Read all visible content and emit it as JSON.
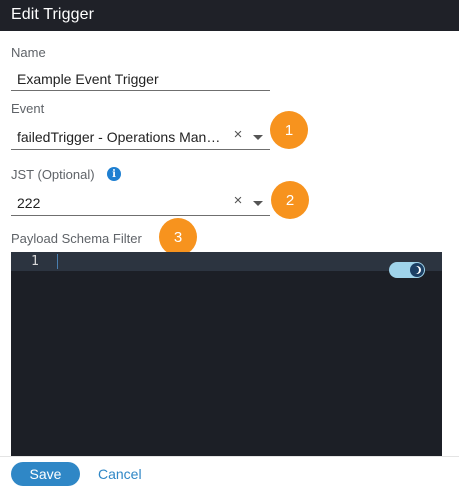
{
  "dialog": {
    "title": "Edit Trigger"
  },
  "name_field": {
    "label": "Name",
    "value": "Example Event Trigger"
  },
  "event_field": {
    "label": "Event",
    "value": "failedTrigger - Operations Mana...",
    "clear_icon": "close-icon",
    "dropdown_icon": "caret-down-icon"
  },
  "jst_field": {
    "label": "JST (Optional)",
    "info_icon": "info-icon",
    "info_glyph": "i",
    "value": "222",
    "clear_icon": "close-icon",
    "dropdown_icon": "caret-down-icon"
  },
  "payload_filter": {
    "label": "Payload Schema Filter",
    "line_number": "1",
    "theme_toggle_icon": "moon-icon"
  },
  "callouts": [
    "1",
    "2",
    "3"
  ],
  "footer": {
    "save_label": "Save",
    "cancel_label": "Cancel"
  },
  "colors": {
    "title_bar": "#1f2128",
    "callout": "#f7931e",
    "primary": "#2f87c6",
    "editor_bg": "#1c1f26",
    "toggle": "#9fd3ea"
  }
}
